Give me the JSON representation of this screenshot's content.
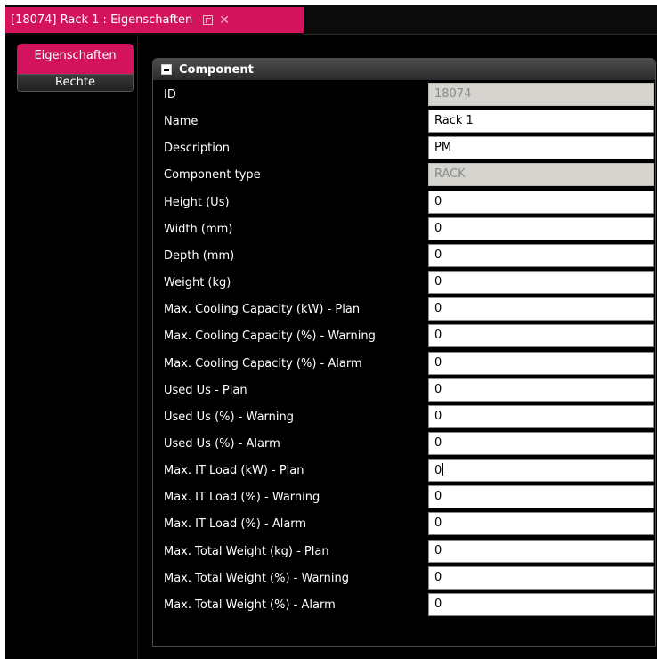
{
  "window": {
    "tab_title": "[18074] Rack 1 : Eigenschaften",
    "pin_icon": "pin-icon",
    "close_icon": "close-icon",
    "close_glyph": "✕"
  },
  "side_tabs": [
    {
      "label": "Eigenschaften",
      "active": true
    },
    {
      "label": "Rechte",
      "active": false
    }
  ],
  "panel": {
    "title": "Component",
    "collapse_icon": "collapse-icon"
  },
  "fields": [
    {
      "label": "ID",
      "value": "18074",
      "readonly": true
    },
    {
      "label": "Name",
      "value": "Rack 1",
      "readonly": false
    },
    {
      "label": "Description",
      "value": "PM",
      "readonly": false
    },
    {
      "label": "Component type",
      "value": "RACK",
      "readonly": true
    },
    {
      "label": "Height (Us)",
      "value": "0",
      "readonly": false
    },
    {
      "label": "Width (mm)",
      "value": "0",
      "readonly": false
    },
    {
      "label": "Depth (mm)",
      "value": "0",
      "readonly": false
    },
    {
      "label": "Weight (kg)",
      "value": "0",
      "readonly": false
    },
    {
      "label": "Max. Cooling Capacity (kW) - Plan",
      "value": "0",
      "readonly": false
    },
    {
      "label": "Max. Cooling Capacity (%) - Warning",
      "value": "0",
      "readonly": false
    },
    {
      "label": "Max. Cooling Capacity (%) - Alarm",
      "value": "0",
      "readonly": false
    },
    {
      "label": "Used Us - Plan",
      "value": "0",
      "readonly": false
    },
    {
      "label": "Used Us (%) - Warning",
      "value": "0",
      "readonly": false
    },
    {
      "label": "Used Us (%) - Alarm",
      "value": "0",
      "readonly": false
    },
    {
      "label": "Max. IT Load (kW) - Plan",
      "value": "0",
      "readonly": false,
      "focused": true
    },
    {
      "label": "Max. IT Load (%) - Warning",
      "value": "0",
      "readonly": false
    },
    {
      "label": "Max. IT Load (%) - Alarm",
      "value": "0",
      "readonly": false
    },
    {
      "label": "Max. Total Weight (kg) - Plan",
      "value": "0",
      "readonly": false
    },
    {
      "label": "Max. Total Weight (%) - Warning",
      "value": "0",
      "readonly": false
    },
    {
      "label": "Max. Total Weight (%) - Alarm",
      "value": "0",
      "readonly": false
    }
  ],
  "colors": {
    "accent": "#d3145d",
    "background": "#000000",
    "readonly_field": "#d6d4cf"
  }
}
